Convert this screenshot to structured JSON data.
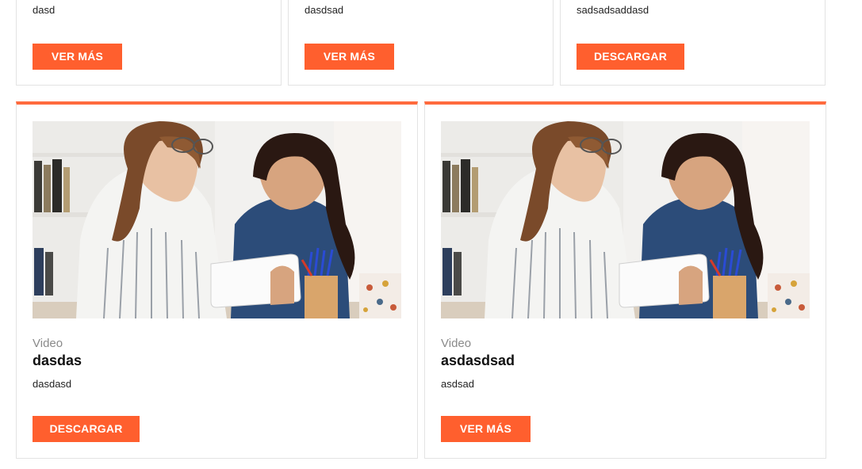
{
  "colors": {
    "accent": "#ff5f2e",
    "border": "#e3e3e3",
    "category": "#8a8a8a"
  },
  "top_cards": [
    {
      "description": "dasd",
      "button": "VER MÁS"
    },
    {
      "description": "dasdsad",
      "button": "VER MÁS"
    },
    {
      "description": "sadsadsaddasd",
      "button": "DESCARGAR"
    }
  ],
  "cards": [
    {
      "image": "two-women-with-tablet-photo",
      "category": "Video",
      "title": "dasdas",
      "description": "dasdasd",
      "button": "DESCARGAR"
    },
    {
      "image": "two-women-with-tablet-photo",
      "category": "Video",
      "title": "asdasdsad",
      "description": "asdsad",
      "button": "VER MÁS"
    }
  ]
}
